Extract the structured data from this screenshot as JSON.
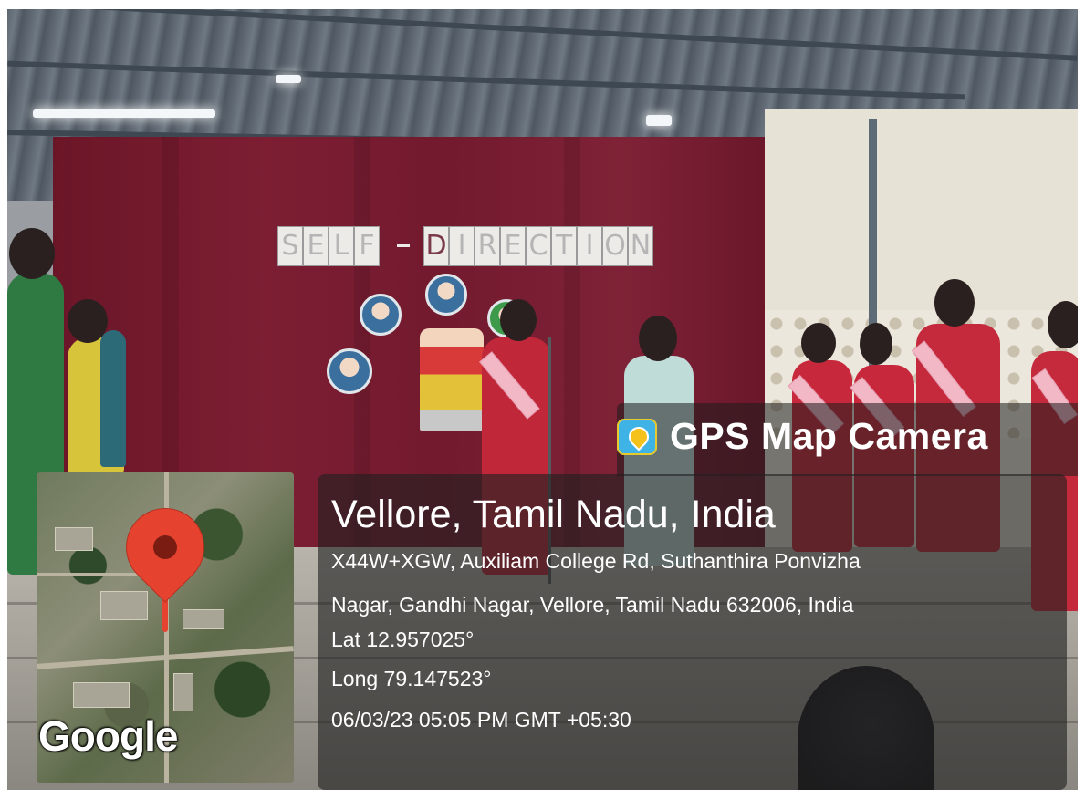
{
  "scene": {
    "banner_letters_left": [
      "S",
      "E",
      "L",
      "F"
    ],
    "banner_letters_right": [
      "D",
      "I",
      "R",
      "E",
      "C",
      "T",
      "I",
      "O",
      "N"
    ]
  },
  "gps_overlay": {
    "app_name": "GPS Map Camera",
    "app_icon": "map-pin-camera-icon",
    "location_title": "Vellore, Tamil Nadu, India",
    "address_line_1": "X44W+XGW, Auxiliam College Rd, Suthanthira Ponvizha",
    "address_line_2": "Nagar, Gandhi Nagar, Vellore, Tamil Nadu 632006, India",
    "latitude": "Lat 12.957025°",
    "longitude": "Long 79.147523°",
    "datetime": "06/03/23 05:05 PM GMT +05:30",
    "map_watermark": "Google",
    "pin_color": "#e5432f"
  }
}
